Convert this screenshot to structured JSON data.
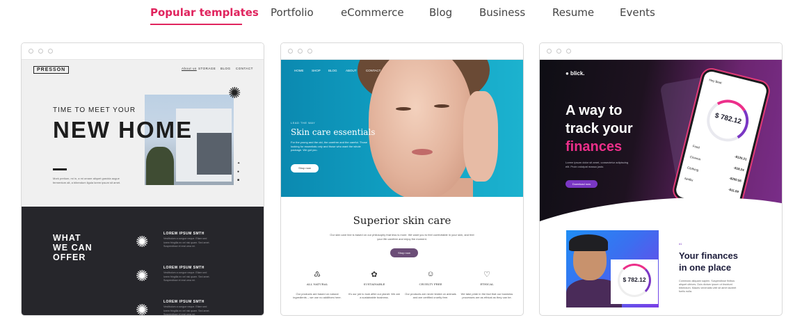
{
  "tabs": [
    {
      "label": "Popular templates",
      "active": true
    },
    {
      "label": "Portfolio",
      "active": false
    },
    {
      "label": "eCommerce",
      "active": false
    },
    {
      "label": "Blog",
      "active": false
    },
    {
      "label": "Business",
      "active": false
    },
    {
      "label": "Resume",
      "active": false
    },
    {
      "label": "Events",
      "active": false
    }
  ],
  "accent_color": "#e0245e",
  "cards": {
    "presson": {
      "logo": "PRESSON",
      "nav": [
        "About us",
        "STORAGE",
        "BLOG",
        "CONTACT"
      ],
      "kicker": "TIME TO MEET YOUR",
      "title": "NEW HOME",
      "body": "Mork pretium, mi in, a mi ornare aliquet gravida augue fermentum alt, a bibendum ligula lorem ipsum sit amet.",
      "what_title": "WHAT\nWE CAN\nOFFER",
      "services": [
        {
          "title": "LOREM IPSUM SMTH",
          "text": "Vestibulum a congue neque. Etiam sed lorem fringilla ex vel nisi quam. Sed amet. Suspendisse et erat urna mi."
        },
        {
          "title": "LOREM IPSUM SMTH",
          "text": "Vestibulum a congue neque. Etiam sed lorem fringilla ex vel nisi quam. Sed amet. Suspendisse et erat urna mi."
        },
        {
          "title": "LOREM IPSUM SMTH",
          "text": "Vestibulum a congue neque. Etiam sed lorem fringilla ex vel nisi quam. Sed amet. Suspendisse et erat urna mi."
        }
      ]
    },
    "skincare": {
      "nav": [
        "HOME",
        "SHOP",
        "BLOG",
        "ABOUT",
        "CONTACT"
      ],
      "lead": "LEAD THE WAY",
      "heading": "Skin care essentials",
      "text": "For the young and the old, the carefree and the careful. Those looking for essentials only and those who want the whole package. We got you.",
      "button": "Shop now",
      "section_title": "Superior skin care",
      "section_text": "Our skin care line is based on our philosophy that less is more. We want you to feel comfortable in your skin, and feel your life carefree and enjoy the moment.",
      "section_button": "Shop now",
      "features": [
        {
          "icon": "♳",
          "title": "ALL NATURAL",
          "text": "Our products are based on natural ingredients – we use no additives here."
        },
        {
          "icon": "✿",
          "title": "SUSTAINABLE",
          "text": "It's our job to look after our planet. We are a sustainable business."
        },
        {
          "icon": "☺",
          "title": "CRUELTY FREE",
          "text": "Our products are never tested on animals and are certified cruelty free."
        },
        {
          "icon": "♡",
          "title": "ETHICAL",
          "text": "We take pride in the fact that our business processes are as ethical as they can be."
        }
      ]
    },
    "blick": {
      "logo": "● blick.",
      "heading_1": "A way to",
      "heading_2": "track your",
      "heading_3": "finances",
      "text": "Lorem ipsum dolor sit amet, consectetur adipiscing elit. Proin volutpat massa justo.",
      "button": "Download now",
      "phone_user": "Hey Beat",
      "phone_amount": "$ 782.12",
      "phone_rows": [
        {
          "label": "Food",
          "value": "-$120.21"
        },
        {
          "label": "Cinema",
          "value": "-$18.24"
        },
        {
          "label": "Clothing",
          "value": "-$250.56"
        },
        {
          "label": "Netflix",
          "value": "-$11.99"
        }
      ],
      "mini_amount": "$ 782.12",
      "section_number": "#1",
      "section_title": "Your finances\nin one place",
      "section_text": "Commodo aliquam sapien. Suspendisse finibus aliquet ultrices. Duis dictum ipsum ut tincidunt bibendum. Mauris venenatis velit sit amet laoreet fuelis nulla."
    }
  }
}
